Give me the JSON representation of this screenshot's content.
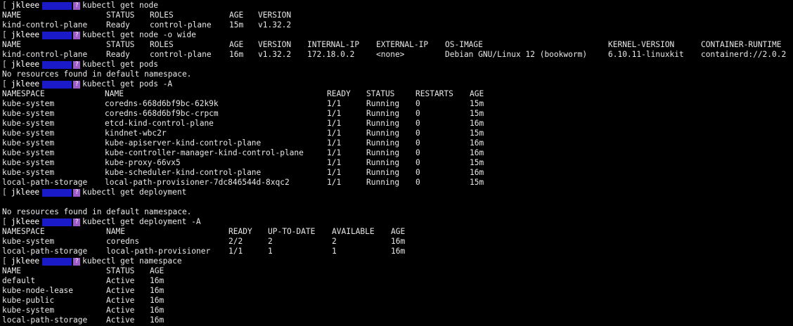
{
  "prompt": {
    "bracket": "[",
    "user": "jkleee",
    "icon": "question-mark-icon",
    "accent_host": "#1a1ac8",
    "accent_icon": "#9c5cc8"
  },
  "sections": [
    {
      "command": "kubectl get node",
      "columns": [
        0,
        148,
        210,
        323,
        364
      ],
      "rows": [
        [
          "NAME",
          "STATUS",
          "ROLES",
          "AGE",
          "VERSION"
        ],
        [
          "kind-control-plane",
          "Ready",
          "control-plane",
          "15m",
          "v1.32.2"
        ]
      ]
    },
    {
      "command": "kubectl get node -o wide",
      "columns": [
        0,
        148,
        210,
        323,
        364,
        434,
        532,
        630,
        862,
        994
      ],
      "rows": [
        [
          "NAME",
          "STATUS",
          "ROLES",
          "AGE",
          "VERSION",
          "INTERNAL-IP",
          "EXTERNAL-IP",
          "OS-IMAGE",
          "KERNEL-VERSION",
          "CONTAINER-RUNTIME"
        ],
        [
          "kind-control-plane",
          "Ready",
          "control-plane",
          "16m",
          "v1.32.2",
          "172.18.0.2",
          "<none>",
          "Debian GNU/Linux 12 (bookworm)",
          "6.10.11-linuxkit",
          "containerd://2.0.2"
        ]
      ]
    },
    {
      "command": "kubectl get pods",
      "columns": [
        0
      ],
      "rows": [
        [
          "No resources found in default namespace."
        ]
      ]
    },
    {
      "command": "kubectl get pods -A",
      "columns": [
        0,
        146,
        462,
        518,
        588,
        665
      ],
      "rows": [
        [
          "NAMESPACE",
          "NAME",
          "READY",
          "STATUS",
          "RESTARTS",
          "AGE"
        ],
        [
          "kube-system",
          "coredns-668d6bf9bc-62k9k",
          "1/1",
          "Running",
          "0",
          "15m"
        ],
        [
          "kube-system",
          "coredns-668d6bf9bc-crpcm",
          "1/1",
          "Running",
          "0",
          "15m"
        ],
        [
          "kube-system",
          "etcd-kind-control-plane",
          "1/1",
          "Running",
          "0",
          "16m"
        ],
        [
          "kube-system",
          "kindnet-wbc2r",
          "1/1",
          "Running",
          "0",
          "15m"
        ],
        [
          "kube-system",
          "kube-apiserver-kind-control-plane",
          "1/1",
          "Running",
          "0",
          "16m"
        ],
        [
          "kube-system",
          "kube-controller-manager-kind-control-plane",
          "1/1",
          "Running",
          "0",
          "16m"
        ],
        [
          "kube-system",
          "kube-proxy-66vx5",
          "1/1",
          "Running",
          "0",
          "15m"
        ],
        [
          "kube-system",
          "kube-scheduler-kind-control-plane",
          "1/1",
          "Running",
          "0",
          "16m"
        ],
        [
          "local-path-storage",
          "local-path-provisioner-7dc846544d-8xqc2",
          "1/1",
          "Running",
          "0",
          "15m"
        ]
      ]
    },
    {
      "command": "kubectl get deployment",
      "columns": [
        0
      ],
      "rows": [
        [
          ""
        ],
        [
          "No resources found in default namespace."
        ]
      ]
    },
    {
      "command": "kubectl get deployment -A",
      "columns": [
        0,
        148,
        322,
        378,
        469,
        553
      ],
      "rows": [
        [
          "NAMESPACE",
          "NAME",
          "READY",
          "UP-TO-DATE",
          "AVAILABLE",
          "AGE"
        ],
        [
          "kube-system",
          "coredns",
          "2/2",
          "2",
          "2",
          "16m"
        ],
        [
          "local-path-storage",
          "local-path-provisioner",
          "1/1",
          "1",
          "1",
          "16m"
        ]
      ]
    },
    {
      "command": "kubectl get namespace",
      "columns": [
        0,
        148,
        210
      ],
      "rows": [
        [
          "NAME",
          "STATUS",
          "AGE"
        ],
        [
          "default",
          "Active",
          "16m"
        ],
        [
          "kube-node-lease",
          "Active",
          "16m"
        ],
        [
          "kube-public",
          "Active",
          "16m"
        ],
        [
          "kube-system",
          "Active",
          "16m"
        ],
        [
          "local-path-storage",
          "Active",
          "16m"
        ]
      ]
    }
  ]
}
